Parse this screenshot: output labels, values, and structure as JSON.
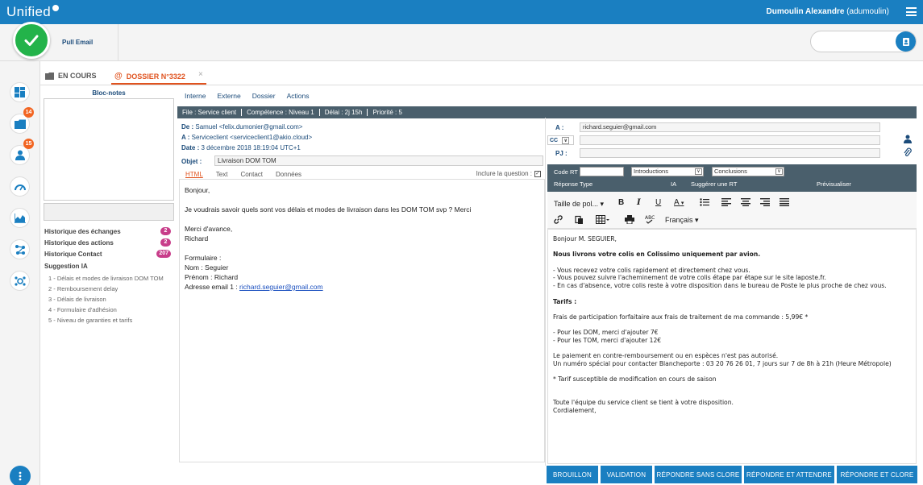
{
  "app": {
    "logo": "Unified",
    "user_name": "Dumoulin Alexandre",
    "user_login": "(adumoulin)"
  },
  "toolbar": {
    "pull_email": "Pull Email"
  },
  "sidebar": {
    "badges": {
      "folder": "14",
      "person": "15"
    }
  },
  "tabs": [
    {
      "label": "EN COURS",
      "icon": "folder-icon"
    },
    {
      "label": "DOSSIER N°3322",
      "icon": "at-icon",
      "active": true
    }
  ],
  "left": {
    "bloc_notes": "Bloc-notes",
    "history": [
      {
        "label": "Historique des échanges",
        "count": "2"
      },
      {
        "label": "Historique des actions",
        "count": "2"
      },
      {
        "label": "Historique Contact",
        "count": "207"
      }
    ],
    "suggestion_title": "Suggestion IA",
    "suggestions": [
      "1 - Délais et modes de livraison DOM TOM",
      "2 - Remboursement delay",
      "3 - Délais de livraison",
      "4 - Formulaire d'adhésion",
      "5 - Niveau de garanties et tarifs"
    ]
  },
  "subtabs": [
    "Interne",
    "Externe",
    "Dossier",
    "Actions"
  ],
  "infobar": [
    "File : Service client",
    "Compétence : Niveau 1",
    "Délai : 2j 15h",
    "Priorité : 5"
  ],
  "message": {
    "de_label": "De :",
    "de_value": "Samuel <felix.dumonier@gmail.com>",
    "a_label": "A :",
    "a_value": "Serviceclient <serviceclient1@akio.cloud>",
    "date_label": "Date :",
    "date_value": "3 décembre 2018 18:19:04 UTC+1",
    "objet_label": "Objet :",
    "objet_value": "Livraison DOM TOM",
    "tabs": [
      "HTML",
      "Text",
      "Contact",
      "Données"
    ],
    "inclure": "Inclure la question :",
    "inclure_check": "✓",
    "body": [
      "Bonjour,",
      "",
      "Je voudrais savoir quels sont vos délais et modes de livraison dans les DOM TOM svp ? Merci",
      "",
      "Merci d'avance,",
      "Richard",
      "",
      "Formulaire :",
      "Nom : Seguier",
      "Prénom : Richard"
    ],
    "email_prefix": "Adresse email 1 : ",
    "email_link": "richard.seguier@gmail.com"
  },
  "reply": {
    "a_label": "A :",
    "a_value": "richard.seguier@gmail.com",
    "cc_label": "CC",
    "cc_arrow": "∨",
    "pj_label": "PJ :",
    "code_rt": "Code RT",
    "select1": "Introductions",
    "select2": "Conclusions",
    "select_arrow": "∨",
    "reponse_type": "Réponse Type",
    "ia": "IA",
    "suggerer": "Suggérer une RT",
    "previsualiser": "Prévisualiser",
    "font_size": "Taille de pol...",
    "language": "Français",
    "body": [
      {
        "t": "Bonjour M. SEGUIER,",
        "b": false
      },
      {
        "t": "",
        "b": false
      },
      {
        "t": "Nous livrons votre colis en Colissimo uniquement par avion.",
        "b": true
      },
      {
        "t": "",
        "b": false
      },
      {
        "t": "- Vous recevez votre colis rapidement et directement chez vous.",
        "b": false
      },
      {
        "t": "- Vous pouvez suivre l'acheminement de votre colis étape par étape sur le site laposte.fr.",
        "b": false
      },
      {
        "t": "- En cas d'absence, votre colis reste à votre disposition dans le bureau de Poste le plus proche de chez vous.",
        "b": false
      },
      {
        "t": "",
        "b": false
      },
      {
        "t": "Tarifs :",
        "b": true
      },
      {
        "t": "",
        "b": false
      },
      {
        "t": "Frais de participation forfaitaire aux frais de traitement de ma commande : 5,99€ *",
        "b": false
      },
      {
        "t": "",
        "b": false
      },
      {
        "t": "- Pour les DOM, merci d'ajouter 7€",
        "b": false
      },
      {
        "t": "- Pour les TOM, merci d'ajouter 12€",
        "b": false
      },
      {
        "t": "",
        "b": false
      },
      {
        "t": "Le paiement en contre-remboursement ou en espèces n'est pas autorisé.",
        "b": false
      },
      {
        "t": "Un numéro spécial pour contacter Blancheporte : 03 20 76 26 01, 7 jours sur 7 de 8h à 21h (Heure Métropole)",
        "b": false
      },
      {
        "t": "",
        "b": false
      },
      {
        "t": "* Tarif susceptible de modification en cours de saison",
        "b": false
      },
      {
        "t": "",
        "b": false
      },
      {
        "t": "",
        "b": false
      },
      {
        "t": "Toute l'équipe du service client se tient à votre disposition.",
        "b": false
      },
      {
        "t": "Cordialement,",
        "b": false
      }
    ]
  },
  "actions": [
    "BROUILLON",
    "VALIDATION",
    "RÉPONDRE SANS CLORE",
    "RÉPONDRE ET ATTENDRE",
    "RÉPONDRE ET CLORE"
  ],
  "colors": {
    "primary": "#1a7fc1",
    "accent": "#e0531f",
    "dark_bar": "#4a5f6c",
    "success": "#23b34a",
    "badge": "#f26522",
    "pill": "#c83d8a"
  }
}
